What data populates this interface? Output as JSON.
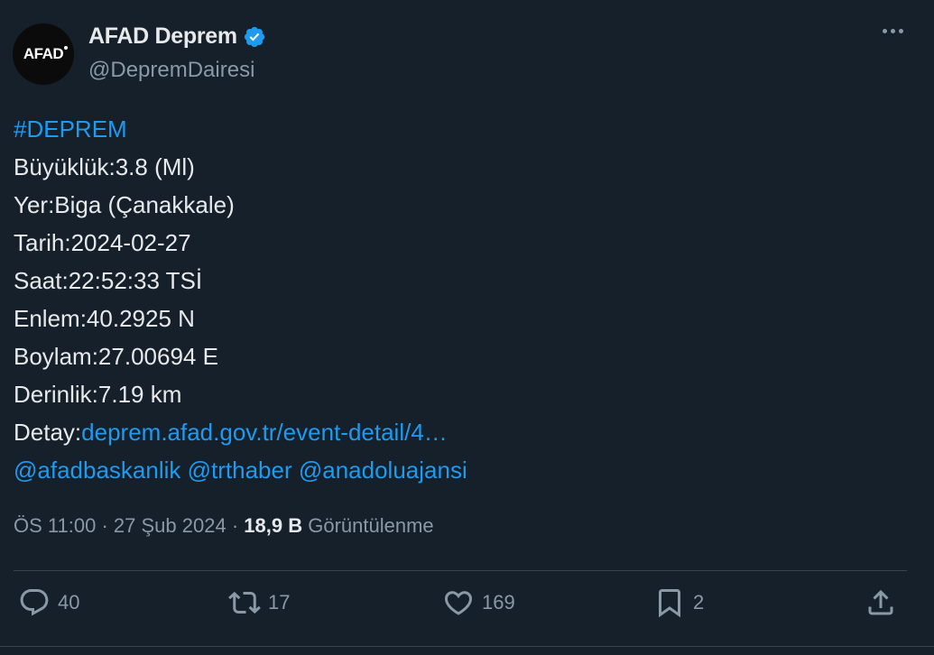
{
  "author": {
    "avatar_text": "AFAD",
    "display_name": "AFAD Deprem",
    "handle": "@DepremDairesi"
  },
  "tweet": {
    "hashtag": "#DEPREM",
    "lines": [
      "Büyüklük:3.8 (Ml)",
      "Yer:Biga (Çanakkale)",
      "Tarih:2024-02-27",
      "Saat:22:52:33 TSİ",
      "Enlem:40.2925 N",
      "Boylam:27.00694 E",
      "Derinlik:7.19 km"
    ],
    "detail_label": "Detay:",
    "detail_link": "deprem.afad.gov.tr/event-detail/4…",
    "mentions": [
      "@afadbaskanlik",
      "@trthaber",
      "@anadoluajansi"
    ]
  },
  "meta": {
    "time": "ÖS 11:00",
    "date": "27 Şub 2024",
    "views_count": "18,9 B",
    "views_label": "Görüntülenme"
  },
  "actions": {
    "replies": "40",
    "retweets": "17",
    "likes": "169",
    "bookmarks": "2"
  },
  "colors": {
    "background": "#15202b",
    "link": "#1d9bf0",
    "muted": "#8b98a5",
    "text": "#e7e9ea",
    "verified": "#1d9bf0"
  }
}
